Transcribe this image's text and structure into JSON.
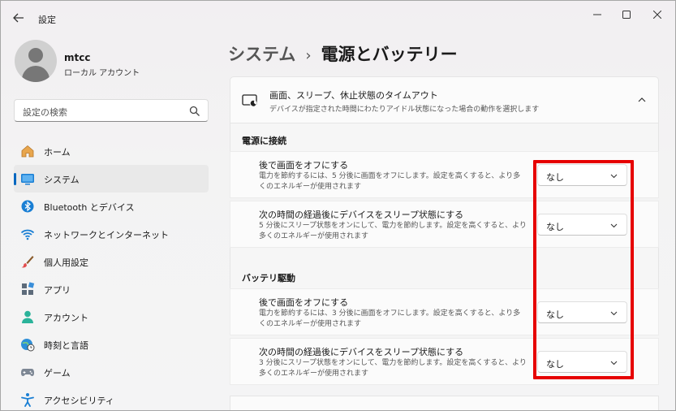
{
  "window": {
    "title": "設定"
  },
  "account": {
    "name": "mtcc",
    "type": "ローカル アカウント"
  },
  "search": {
    "placeholder": "設定の検索"
  },
  "nav": {
    "items": [
      {
        "label": "ホーム",
        "icon": "home-icon"
      },
      {
        "label": "システム",
        "icon": "system-icon",
        "active": true
      },
      {
        "label": "Bluetooth とデバイス",
        "icon": "bluetooth-icon"
      },
      {
        "label": "ネットワークとインターネット",
        "icon": "wifi-icon"
      },
      {
        "label": "個人用設定",
        "icon": "brush-icon"
      },
      {
        "label": "アプリ",
        "icon": "apps-icon"
      },
      {
        "label": "アカウント",
        "icon": "account-icon"
      },
      {
        "label": "時刻と言語",
        "icon": "globe-clock-icon"
      },
      {
        "label": "ゲーム",
        "icon": "gamepad-icon"
      },
      {
        "label": "アクセシビリティ",
        "icon": "accessibility-icon"
      }
    ]
  },
  "breadcrumb": {
    "parent": "システム",
    "separator": "›",
    "current": "電源とバッテリー"
  },
  "card": {
    "title": "画面、スリープ、休止状態のタイムアウト",
    "subtitle": "デバイスが指定された時間にわたりアイドル状態になった場合の動作を選択します"
  },
  "sections": [
    {
      "label": "電源に接続",
      "settings": [
        {
          "title": "後で画面をオフにする",
          "description": "電力を節約するには、5 分後に画面をオフにします。設定を高くすると、より多くのエネルギーが使用されます",
          "value": "なし"
        },
        {
          "title": "次の時間の経過後にデバイスをスリープ状態にする",
          "description": "5 分後にスリープ状態をオンにして、電力を節約します。設定を高くすると、より多くのエネルギーが使用されます",
          "value": "なし"
        }
      ]
    },
    {
      "label": "バッテリ駆動",
      "settings": [
        {
          "title": "後で画面をオフにする",
          "description": "電力を節約するには、3 分後に画面をオフにします。設定を高くすると、より多くのエネルギーが使用されます",
          "value": "なし"
        },
        {
          "title": "次の時間の経過後にデバイスをスリープ状態にする",
          "description": "3 分後にスリープ状態をオンにして、電力を節約します。設定を高くすると、より多くのエネルギーが使用されます",
          "value": "なし"
        }
      ]
    }
  ],
  "colors": {
    "accent": "#0067c0",
    "highlight": "#e60000"
  }
}
